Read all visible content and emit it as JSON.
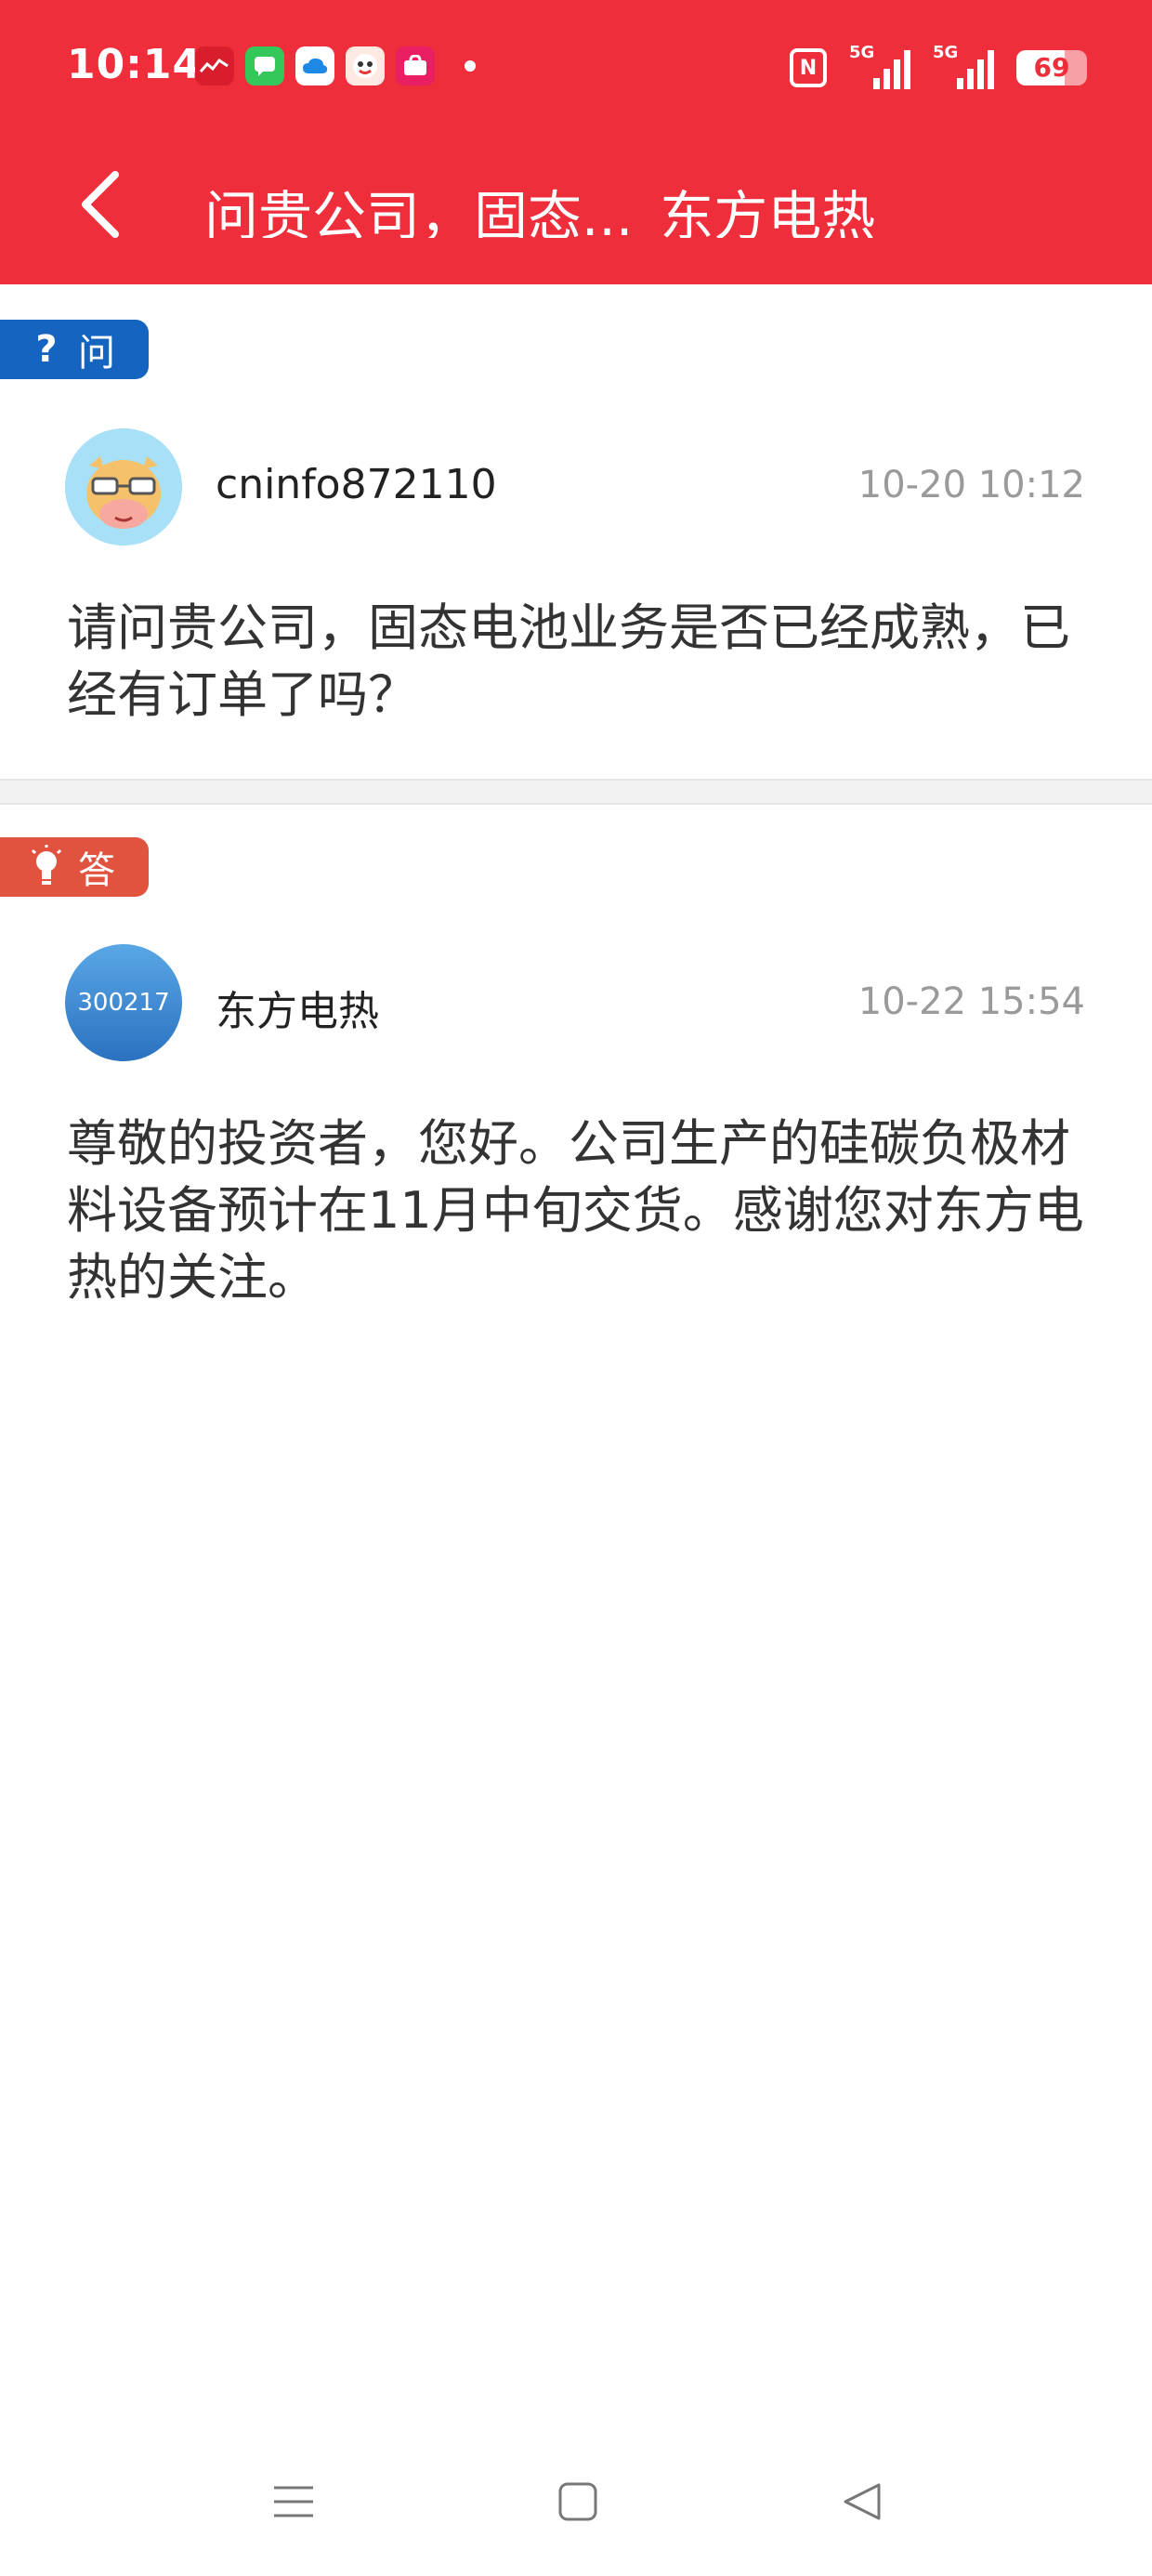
{
  "status_bar": {
    "time": "10:14",
    "network1": "5G",
    "network2": "5G",
    "battery_level": "69",
    "battery_fraction": 0.69
  },
  "nav": {
    "title": "问贵公司，固态..._东方电热_",
    "back_icon": "chevron-left-icon"
  },
  "question": {
    "tag_label": "问",
    "tag_icon": "question-icon",
    "author": "cninfo872110",
    "time": "10-20 10:12",
    "content": "请问贵公司，固态电池业务是否已经成熟，已经有订单了吗？"
  },
  "answer": {
    "tag_label": "答",
    "tag_icon": "lightbulb-icon",
    "avatar_code": "300217",
    "author": "东方电热",
    "time": "10-22 15:54",
    "content": "尊敬的投资者，您好。公司生产的硅碳负极材料设备预计在11月中旬交货。感谢您对东方电热的关注。"
  },
  "colors": {
    "header_red": "#EE2F3B",
    "question_blue": "#1565C0",
    "answer_red": "#E0533F",
    "time_gray": "#9a9a9a"
  }
}
